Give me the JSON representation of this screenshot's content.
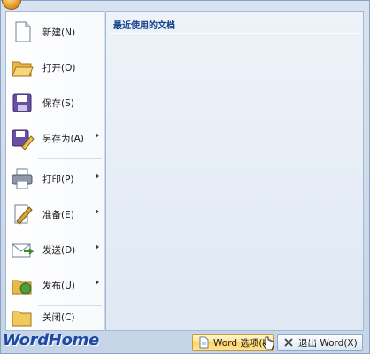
{
  "menu": {
    "items": [
      {
        "label": "新建(N)",
        "icon": "new-document-icon",
        "submenu": false
      },
      {
        "label": "打开(O)",
        "icon": "open-folder-icon",
        "submenu": false
      },
      {
        "label": "保存(S)",
        "icon": "save-floppy-icon",
        "submenu": false
      },
      {
        "label": "另存为(A)",
        "icon": "save-as-icon",
        "submenu": true
      },
      {
        "label": "打印(P)",
        "icon": "printer-icon",
        "submenu": true
      },
      {
        "label": "准备(E)",
        "icon": "prepare-pen-icon",
        "submenu": true
      },
      {
        "label": "发送(D)",
        "icon": "send-mail-icon",
        "submenu": true
      },
      {
        "label": "发布(U)",
        "icon": "publish-icon",
        "submenu": true
      },
      {
        "label": "关闭(C)",
        "icon": "close-folder-icon",
        "submenu": false
      }
    ]
  },
  "recent": {
    "title": "最近使用的文档"
  },
  "footer": {
    "options_label": "Word 选项(I)",
    "exit_label": "退出 Word(X)"
  },
  "watermark": "WordHome",
  "colors": {
    "title_blue": "#15428b",
    "watermark_blue": "#1d4aa5",
    "hover_gold": "#ffd25c"
  }
}
